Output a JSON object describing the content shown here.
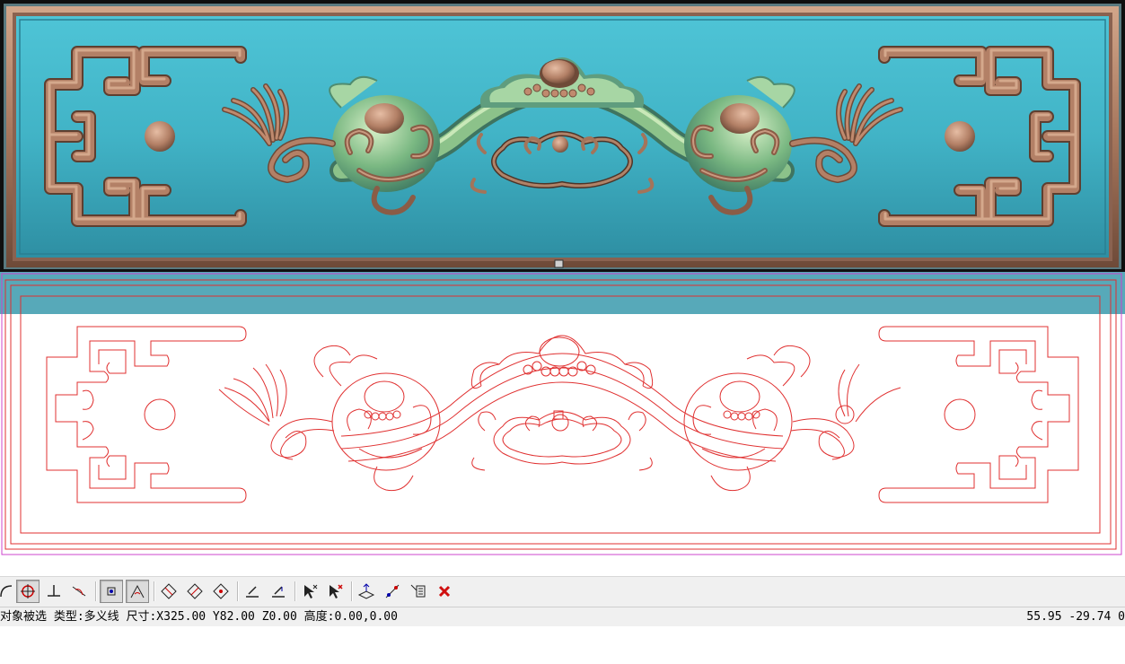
{
  "toolbar": {
    "buttons": [
      {
        "name": "arc-tool-icon"
      },
      {
        "name": "circle-snap-icon",
        "pressed": true
      },
      {
        "name": "perpendicular-icon"
      },
      {
        "name": "tangent-icon"
      },
      {
        "name": "node-select-icon",
        "pressed": true
      },
      {
        "name": "angle-icon",
        "pressed": true
      },
      {
        "name": "diamond-a-icon"
      },
      {
        "name": "diamond-b-icon"
      },
      {
        "name": "diamond-c-icon"
      },
      {
        "name": "align-bottom-icon"
      },
      {
        "name": "align-bottom-arrow-icon"
      },
      {
        "name": "pointer-add-icon"
      },
      {
        "name": "pointer-remove-icon"
      },
      {
        "name": "transform-icon"
      },
      {
        "name": "pick-path-icon"
      },
      {
        "name": "list-select-icon"
      },
      {
        "name": "delete-icon"
      }
    ]
  },
  "status": {
    "selection_text": "对象被选 类型:多义线 尺寸:X325.00 Y82.00 Z0.00 高度:0.00,0.00",
    "coords": "55.95 -29.74 0"
  },
  "colors": {
    "relief_bg": "#45b3c7",
    "relief_frame": "#b08368",
    "relief_green": "#8cc28a",
    "vector_line": "#e03030",
    "bounding_box": "#cc44cc"
  }
}
